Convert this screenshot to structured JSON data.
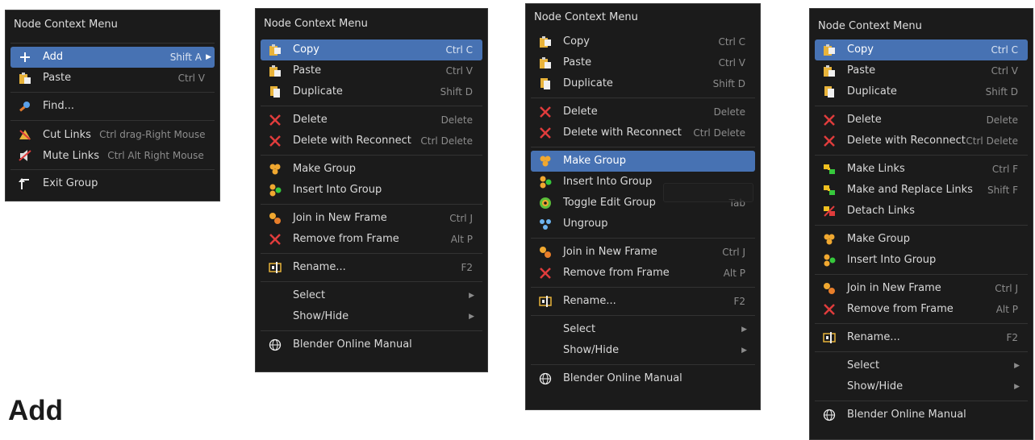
{
  "menu1": {
    "title": "Node Context Menu",
    "add": {
      "label": "Add",
      "shortcut": "Shift A"
    },
    "paste": {
      "label": "Paste",
      "shortcut": "Ctrl V"
    },
    "find": {
      "label": "Find..."
    },
    "cut_links": {
      "label": "Cut Links",
      "shortcut": "Ctrl drag-Right Mouse"
    },
    "mute_links": {
      "label": "Mute Links",
      "shortcut": "Ctrl Alt Right Mouse"
    },
    "exit_group": {
      "label": "Exit Group"
    }
  },
  "menu2": {
    "title": "Node Context Menu",
    "copy": {
      "label": "Copy",
      "shortcut": "Ctrl C"
    },
    "paste": {
      "label": "Paste",
      "shortcut": "Ctrl V"
    },
    "duplicate": {
      "label": "Duplicate",
      "shortcut": "Shift D"
    },
    "delete": {
      "label": "Delete",
      "shortcut": "Delete"
    },
    "delete_reconnect": {
      "label": "Delete with Reconnect",
      "shortcut": "Ctrl Delete"
    },
    "make_group": {
      "label": "Make Group"
    },
    "insert_group": {
      "label": "Insert Into Group"
    },
    "join_frame": {
      "label": "Join in New Frame",
      "shortcut": "Ctrl J"
    },
    "remove_frame": {
      "label": "Remove from Frame",
      "shortcut": "Alt P"
    },
    "rename": {
      "label": "Rename...",
      "shortcut": "F2"
    },
    "select": {
      "label": "Select"
    },
    "show_hide": {
      "label": "Show/Hide"
    },
    "manual": {
      "label": "Blender Online Manual"
    }
  },
  "menu3": {
    "title": "Node Context Menu",
    "copy": {
      "label": "Copy",
      "shortcut": "Ctrl C"
    },
    "paste": {
      "label": "Paste",
      "shortcut": "Ctrl V"
    },
    "duplicate": {
      "label": "Duplicate",
      "shortcut": "Shift D"
    },
    "delete": {
      "label": "Delete",
      "shortcut": "Delete"
    },
    "delete_reconnect": {
      "label": "Delete with Reconnect",
      "shortcut": "Ctrl Delete"
    },
    "make_group": {
      "label": "Make Group"
    },
    "insert_group": {
      "label": "Insert Into Group"
    },
    "toggle_edit_group": {
      "label": "Toggle Edit Group",
      "shortcut": "Tab"
    },
    "ungroup": {
      "label": "Ungroup"
    },
    "join_frame": {
      "label": "Join in New Frame",
      "shortcut": "Ctrl J"
    },
    "remove_frame": {
      "label": "Remove from Frame",
      "shortcut": "Alt P"
    },
    "rename": {
      "label": "Rename...",
      "shortcut": "F2"
    },
    "select": {
      "label": "Select"
    },
    "show_hide": {
      "label": "Show/Hide"
    },
    "manual": {
      "label": "Blender Online Manual"
    }
  },
  "menu4": {
    "title": "Node Context Menu",
    "copy": {
      "label": "Copy",
      "shortcut": "Ctrl C"
    },
    "paste": {
      "label": "Paste",
      "shortcut": "Ctrl V"
    },
    "duplicate": {
      "label": "Duplicate",
      "shortcut": "Shift D"
    },
    "delete": {
      "label": "Delete",
      "shortcut": "Delete"
    },
    "delete_reconnect": {
      "label": "Delete with Reconnect",
      "shortcut": "Ctrl Delete"
    },
    "make_links": {
      "label": "Make Links",
      "shortcut": "Ctrl F"
    },
    "make_replace_links": {
      "label": "Make and Replace Links",
      "shortcut": "Shift F"
    },
    "detach_links": {
      "label": "Detach Links"
    },
    "make_group": {
      "label": "Make Group"
    },
    "insert_group": {
      "label": "Insert Into Group"
    },
    "join_frame": {
      "label": "Join in New Frame",
      "shortcut": "Ctrl J"
    },
    "remove_frame": {
      "label": "Remove from Frame",
      "shortcut": "Alt P"
    },
    "rename": {
      "label": "Rename...",
      "shortcut": "F2"
    },
    "select": {
      "label": "Select"
    },
    "show_hide": {
      "label": "Show/Hide"
    },
    "manual": {
      "label": "Blender Online Manual"
    }
  },
  "page_heading": "Add",
  "colors": {
    "menu_bg": "#1b1b1b",
    "highlight": "#4772b3",
    "shortcut_text": "#8c8c8c"
  }
}
